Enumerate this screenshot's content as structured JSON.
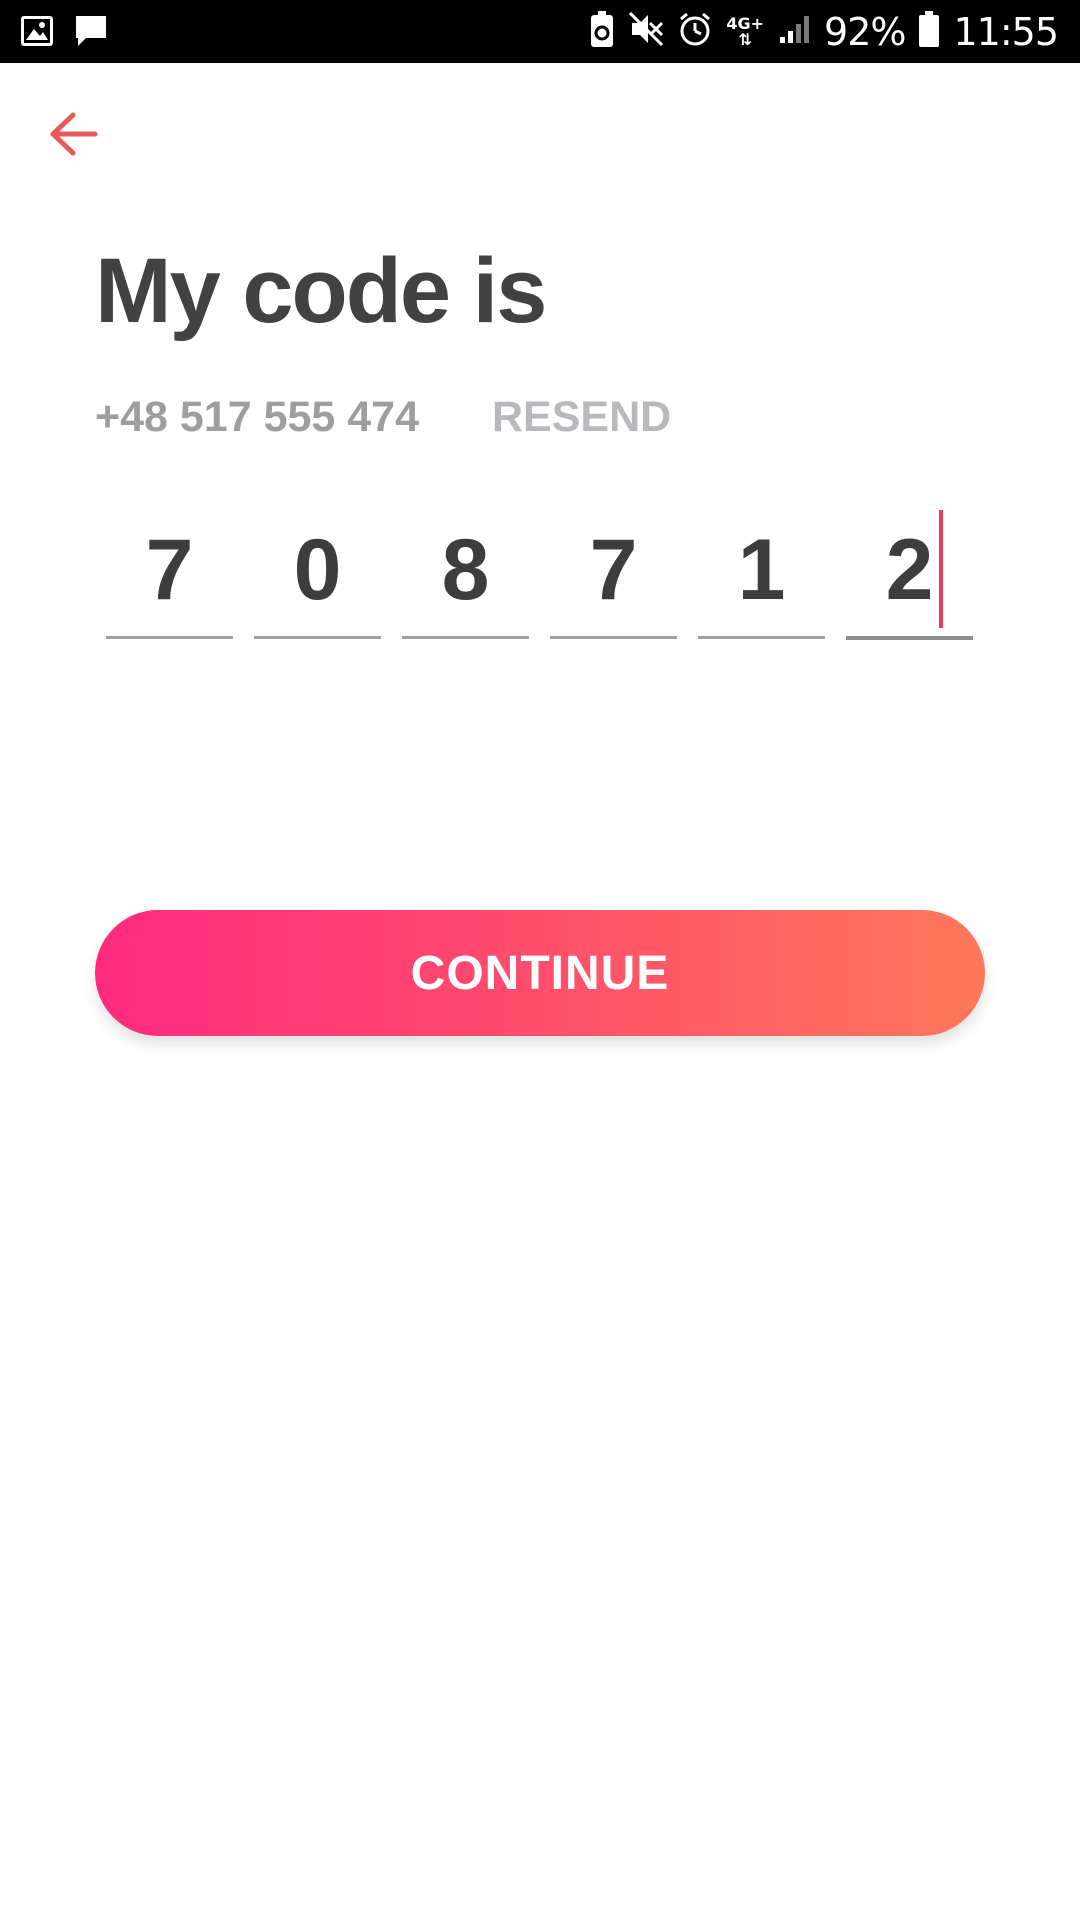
{
  "status_bar": {
    "network_label": "4G+",
    "battery_percent": "92%",
    "time": "11:55",
    "icons": [
      "gallery-icon",
      "message-icon",
      "battery-saver-icon",
      "mute-icon",
      "alarm-icon",
      "data-arrows-icon",
      "signal-icon",
      "battery-icon"
    ]
  },
  "header": {
    "back_icon": "arrow-left-icon",
    "accent_color": "#e65a5a"
  },
  "main": {
    "title": "My code is",
    "phone_number": "+48 517 555 474",
    "resend_label": "RESEND",
    "code_digits": [
      "7",
      "0",
      "8",
      "7",
      "1",
      "2"
    ]
  },
  "continue_button": {
    "label": "CONTINUE",
    "gradient_start": "#ff2a7f",
    "gradient_end": "#ff785a"
  }
}
